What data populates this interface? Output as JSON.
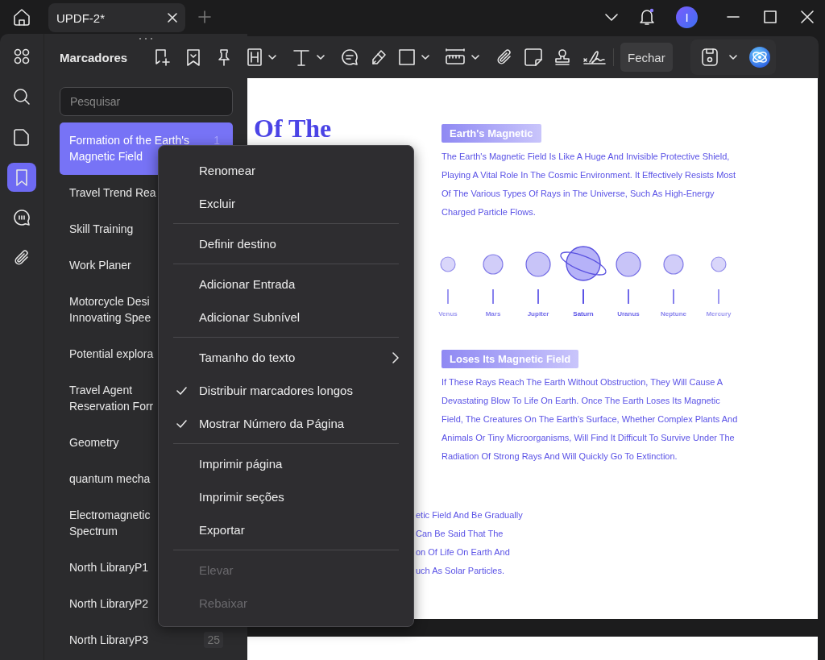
{
  "title_bar": {
    "tab": {
      "title": "UPDF-2*"
    },
    "avatar": "I"
  },
  "left_rail": [
    {
      "kind": "apps",
      "selected": false
    },
    {
      "kind": "search",
      "selected": false
    },
    {
      "kind": "page",
      "selected": false
    },
    {
      "kind": "bookmark",
      "selected": true
    },
    {
      "kind": "comment",
      "selected": false
    },
    {
      "kind": "attachment",
      "selected": false
    }
  ],
  "toolbar": {
    "close_label": "Fechar"
  },
  "bookmarks": {
    "title": "Marcadores",
    "search": {
      "placeholder": "Pesquisar"
    },
    "items": [
      {
        "label": "Formation of the Earth's\nMagnetic Field",
        "page": "1",
        "selected": true
      },
      {
        "label": "Travel Trend Rea",
        "selected": false
      },
      {
        "label": "Skill Training",
        "selected": false
      },
      {
        "label": "Work Planer",
        "selected": false
      },
      {
        "label": "Motorcycle Desi\nInnovating Spee",
        "selected": false
      },
      {
        "label": "Potential explora",
        "selected": false
      },
      {
        "label": "Travel Agent\nReservation Forr",
        "selected": false
      },
      {
        "label": "Geometry",
        "selected": false
      },
      {
        "label": "quantum mecha",
        "selected": false
      },
      {
        "label": "Electromagnetic\nSpectrum",
        "selected": false
      },
      {
        "label": "North LibraryP1",
        "selected": false
      },
      {
        "label": "North LibraryP2",
        "selected": false
      },
      {
        "label": "North LibraryP3",
        "page": "25",
        "selected": false
      }
    ]
  },
  "document": {
    "heading": "Of The",
    "sections": [
      {
        "title": "Earth's Magnetic",
        "body": "The Earth's Magnetic Field Is Like A Huge And Invisible Protective Shield, Playing A Vital Role In The Cosmic Environment. It Effectively Resists Most Of The Various Types Of Rays in The Universe, Such As High-Energy Charged Particle Flows."
      },
      {
        "title": "Loses Its Magnetic Field",
        "body": "If These Rays Reach The Earth Without Obstruction, They Will Cause A Devastating Blow To Life On Earth. Once The Earth Loses Its Magnetic Field, The Creatures On The Earth's Surface, Whether Complex Plants And Animals Or Tiny Microorganisms, Will Find It Difficult To Survive Under The Radiation Of Strong Rays And Will Quickly Go To Extinction."
      }
    ],
    "planets": [
      {
        "name": "Venus",
        "kind": "plain"
      },
      {
        "name": "Mars",
        "kind": "plain"
      },
      {
        "name": "Jupiter",
        "kind": "plain"
      },
      {
        "name": "Saturn",
        "kind": "ringed"
      },
      {
        "name": "Uranus",
        "kind": "plain"
      },
      {
        "name": "Neptune",
        "kind": "plain"
      },
      {
        "name": "Mercury",
        "kind": "plain"
      }
    ],
    "partial_lines": [
      "etic Field And Be Gradually",
      "Can Be Said That The",
      "on Of Life On Earth And",
      "uch As Solar Particles."
    ]
  },
  "context_menu": {
    "items": [
      {
        "kind": "item",
        "label": "Renomear",
        "checked": false,
        "disabled": false,
        "submenu": false
      },
      {
        "kind": "item",
        "label": "Excluir",
        "checked": false,
        "disabled": false,
        "submenu": false
      },
      {
        "kind": "separator"
      },
      {
        "kind": "item",
        "label": "Definir destino",
        "checked": false,
        "disabled": false,
        "submenu": false
      },
      {
        "kind": "separator"
      },
      {
        "kind": "item",
        "label": "Adicionar Entrada",
        "checked": false,
        "disabled": false,
        "submenu": false
      },
      {
        "kind": "item",
        "label": "Adicionar Subnível",
        "checked": false,
        "disabled": false,
        "submenu": false
      },
      {
        "kind": "separator"
      },
      {
        "kind": "item",
        "label": "Tamanho do texto",
        "checked": false,
        "disabled": false,
        "submenu": true
      },
      {
        "kind": "item",
        "label": "Distribuir marcadores longos",
        "checked": true,
        "disabled": false,
        "submenu": false
      },
      {
        "kind": "item",
        "label": "Mostrar Número da Página",
        "checked": true,
        "disabled": false,
        "submenu": false
      },
      {
        "kind": "separator"
      },
      {
        "kind": "item",
        "label": "Imprimir página",
        "checked": false,
        "disabled": false,
        "submenu": false
      },
      {
        "kind": "item",
        "label": "Imprimir seções",
        "checked": false,
        "disabled": false,
        "submenu": false
      },
      {
        "kind": "item",
        "label": "Exportar",
        "checked": false,
        "disabled": false,
        "submenu": false
      },
      {
        "kind": "separator"
      },
      {
        "kind": "item",
        "label": "Elevar",
        "checked": false,
        "disabled": true,
        "submenu": false
      },
      {
        "kind": "item",
        "label": "Rebaixar",
        "checked": false,
        "disabled": true,
        "submenu": false
      }
    ]
  }
}
